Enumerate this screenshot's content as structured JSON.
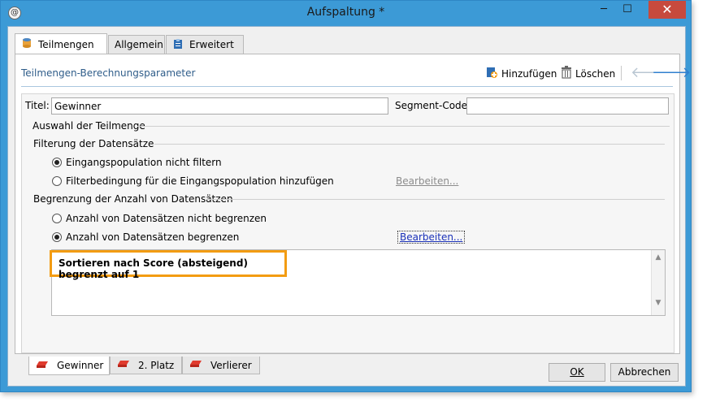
{
  "window": {
    "title": "Aufspaltung *",
    "min": "─",
    "max": "☐",
    "close": "✕"
  },
  "tabs": [
    {
      "label": "Teilmengen",
      "icon": "database-icon"
    },
    {
      "label": "Allgemein",
      "icon": ""
    },
    {
      "label": "Erweitert",
      "icon": "clipboard-icon"
    }
  ],
  "panel": {
    "title": "Teilmengen-Berechnungsparameter",
    "add_label": "Hinzufügen",
    "delete_label": "Löschen",
    "arrow_left": "🡐",
    "arrow_right": "🡒"
  },
  "form": {
    "title_label": "Titel:",
    "title_value": "Gewinner",
    "segment_label": "Segment-Code:",
    "segment_value": "",
    "selection_group": "Auswahl der Teilmenge",
    "filter_group": "Filterung der Datensätze",
    "filter_options": [
      {
        "label": "Eingangspopulation nicht filtern",
        "checked": true
      },
      {
        "label": "Filterbedingung für die Eingangspopulation hinzufügen",
        "checked": false
      }
    ],
    "filter_edit": "Bearbeiten...",
    "limit_group": "Begrenzung der Anzahl von Datensätzen",
    "limit_options": [
      {
        "label": "Anzahl von Datensätzen nicht begrenzen",
        "checked": false
      },
      {
        "label": "Anzahl von Datensätzen begrenzen",
        "checked": true
      }
    ],
    "limit_edit": "Bearbeiten...",
    "summary": "Sortieren nach Score (absteigend) begrenzt auf 1"
  },
  "subsets": [
    {
      "label": "Gewinner",
      "active": true
    },
    {
      "label": "2. Platz",
      "active": false
    },
    {
      "label": "Verlierer",
      "active": false
    }
  ],
  "buttons": {
    "ok": "OK",
    "cancel": "Abbrechen"
  },
  "colors": {
    "titlebar": "#3c9ad6",
    "highlight": "#f39c12",
    "close": "#c74a3d"
  }
}
